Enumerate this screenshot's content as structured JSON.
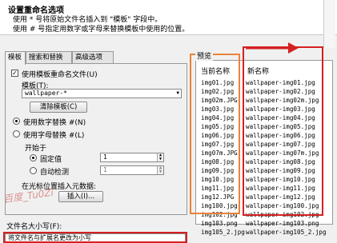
{
  "header": {
    "title": "设置重命名选项",
    "desc1": "使用 * 号将原始文件名插入到 \"模板\" 字段中。",
    "desc2": "使用 # 号指定用数字或字母来替换模板中使用的位置。"
  },
  "tabs": [
    "模板",
    "搜索和替换",
    "高级选项"
  ],
  "template_tab": {
    "use_template_label": "使用模板重命名文件(U)",
    "use_template_checked": true,
    "template_label": "模板(T):",
    "template_value": "wallpaper-*",
    "clear_button": "清除模板(C)",
    "radio_numbers": "使用数字替换 #(N)",
    "radio_numbers_selected": true,
    "radio_letters": "使用字母替换 #(L)",
    "radio_letters_selected": false,
    "start_label": "开始于",
    "fixed_value_label": "固定值",
    "fixed_value": "1",
    "fixed_selected": true,
    "auto_detect_label": "自动检测",
    "auto_detect_value": "1",
    "insert_label": "在光标位置插入元数据:",
    "insert_button": "插入(I)...",
    "case_label": "文件名大小写(F):",
    "case_value": "将文件名与扩展名更改为小写"
  },
  "preview": {
    "label": "预览",
    "col_current": "当前名称",
    "col_new": "新名称",
    "current_names": [
      "img01.jpg",
      "img02.jpg",
      "img02m.JPG",
      "img03.jpg",
      "img04.jpg",
      "img05.jpg",
      "img06.jpg",
      "img07.jpg",
      "img07m.JPG",
      "img08.jpg",
      "img09.jpg",
      "img10.jpg",
      "img11.jpg",
      "img12.JPG",
      "img100.jpg",
      "img102.jpg",
      "img103.png",
      "img105_2.jpg"
    ],
    "new_names": [
      "wallpaper-img01.jpg",
      "wallpaper-img02.jpg",
      "wallpaper-img02m.jpg",
      "wallpaper-img03.jpg",
      "wallpaper-img04.jpg",
      "wallpaper-img05.jpg",
      "wallpaper-img06.jpg",
      "wallpaper-img07.jpg",
      "wallpaper-img07m.jpg",
      "wallpaper-img08.jpg",
      "wallpaper-img09.jpg",
      "wallpaper-img10.jpg",
      "wallpaper-img11.jpg",
      "wallpaper-img12.jpg",
      "wallpaper-img100.jpg",
      "wallpaper-img102.jpg",
      "wallpaper-img103.png",
      "wallpaper-img105_2.jpg"
    ]
  },
  "watermark": "百度_Tu0Zi",
  "colors": {
    "highlight_orange": "#e8833a",
    "highlight_red": "#d42020"
  }
}
